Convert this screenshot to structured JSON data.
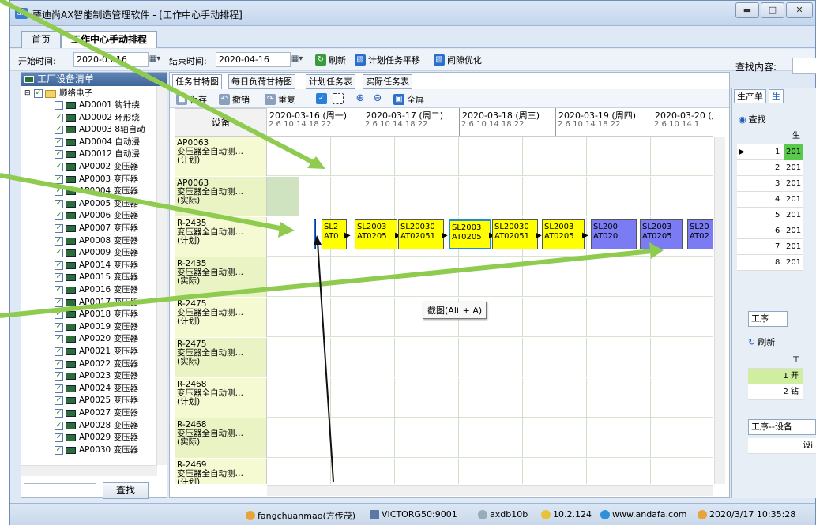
{
  "window": {
    "title": "要迪尚AX智能制造管理软件 - [工作中心手动排程]",
    "icon": "ax",
    "controls": [
      "minimize-icon",
      "maximize-icon",
      "close-icon"
    ]
  },
  "main_tabs": [
    {
      "label": "首页",
      "active": false
    },
    {
      "label": "工作中心手动排程",
      "active": true
    }
  ],
  "toolbar": {
    "start_label": "开始时间:",
    "start_value": "2020-03-16",
    "end_label": "结束时间:",
    "end_value": "2020-04-16",
    "refresh_label": "刷新",
    "shift_label": "计划任务平移",
    "optimize_label": "间隙优化",
    "search_label": "查找内容:"
  },
  "left_panel": {
    "title": "工厂设备清单",
    "root": "顺络电子",
    "items": [
      {
        "label": "AD0001 钩针绕"
      },
      {
        "label": "AD0002 环形绕"
      },
      {
        "label": "AD0003 8轴自动"
      },
      {
        "label": "AD0004 自动浸"
      },
      {
        "label": "AD0012 自动浸"
      },
      {
        "label": "AP0002 变压器"
      },
      {
        "label": "AP0003 变压器"
      },
      {
        "label": "AP0004 变压器"
      },
      {
        "label": "AP0005 变压器"
      },
      {
        "label": "AP0006 变压器"
      },
      {
        "label": "AP0007 变压器"
      },
      {
        "label": "AP0008 变压器"
      },
      {
        "label": "AP0009 变压器"
      },
      {
        "label": "AP0014 变压器"
      },
      {
        "label": "AP0015 变压器"
      },
      {
        "label": "AP0016 变压器"
      },
      {
        "label": "AP0017 变压器"
      },
      {
        "label": "AP0018 变压器"
      },
      {
        "label": "AP0019 变压器"
      },
      {
        "label": "AP0020 变压器"
      },
      {
        "label": "AP0021 变压器"
      },
      {
        "label": "AP0022 变压器"
      },
      {
        "label": "AP0023 变压器"
      },
      {
        "label": "AP0024 变压器"
      },
      {
        "label": "AP0025 变压器"
      },
      {
        "label": "AP0027 变压器"
      },
      {
        "label": "AP0028 变压器"
      },
      {
        "label": "AP0029 变压器"
      },
      {
        "label": "AP0030 变压器"
      }
    ],
    "find_button": "查找"
  },
  "center": {
    "tabs": [
      "任务甘特图",
      "每日负荷甘特图",
      "计划任务表",
      "实际任务表"
    ],
    "gantt_toolbar": {
      "save": "保存",
      "undo": "撤销",
      "redo": "重复",
      "fullscreen": "全屏"
    },
    "device_header": "设备",
    "days": [
      {
        "label": "2020-03-16 (周一)",
        "ticks": "2  6  10 14 18 22"
      },
      {
        "label": "2020-03-17 (周二)",
        "ticks": "2  6  10 14 18 22"
      },
      {
        "label": "2020-03-18 (周三)",
        "ticks": "2  6  10 14 18 22"
      },
      {
        "label": "2020-03-19 (周四)",
        "ticks": "2  6  10 14 18 22"
      },
      {
        "label": "2020-03-20 (周",
        "ticks": "2  6  10 14 1"
      }
    ],
    "rows": [
      {
        "code": "AP0063",
        "name": "变压器全自动测…",
        "kind": "(计划)"
      },
      {
        "code": "AP0063",
        "name": "变压器全自动测…",
        "kind": "(实际)"
      },
      {
        "code": "R-2435",
        "name": "变压器全自动测…",
        "kind": "(计划)"
      },
      {
        "code": "R-2435",
        "name": "变压器全自动测…",
        "kind": "(实际)"
      },
      {
        "code": "R-2475",
        "name": "变压器全自动测…",
        "kind": "(计划)"
      },
      {
        "code": "R-2475",
        "name": "变压器全自动测…",
        "kind": "(实际)"
      },
      {
        "code": "R-2468",
        "name": "变压器全自动测…",
        "kind": "(计划)"
      },
      {
        "code": "R-2468",
        "name": "变压器全自动测…",
        "kind": "(实际)"
      },
      {
        "code": "R-2469",
        "name": "变压器全自动测…",
        "kind": "(计划)"
      }
    ],
    "bars": [
      {
        "l1": "SL2",
        "l2": "AT0",
        "color": "yellow"
      },
      {
        "l1": "SL2003",
        "l2": "AT0205",
        "color": "yellow"
      },
      {
        "l1": "SL20030",
        "l2": "AT02051",
        "color": "yellow"
      },
      {
        "l1": "SL2003",
        "l2": "AT0205",
        "color": "yellow",
        "selected": true
      },
      {
        "l1": "SL20030",
        "l2": "AT02051",
        "color": "yellow"
      },
      {
        "l1": "SL2003",
        "l2": "AT0205",
        "color": "yellow"
      },
      {
        "l1": "SL200",
        "l2": "AT020",
        "color": "blue"
      },
      {
        "l1": "SL2003",
        "l2": "AT0205",
        "color": "blue"
      },
      {
        "l1": "SL20",
        "l2": "AT02",
        "color": "blue"
      }
    ],
    "tooltip": "截图(Alt + A)",
    "last_row_code": "R-2469"
  },
  "right_panel": {
    "tabs": [
      "生产单",
      "生"
    ],
    "find": "查找",
    "grid_header": "生",
    "grid_rows": [
      {
        "n": "1",
        "v": "201"
      },
      {
        "n": "2",
        "v": "201"
      },
      {
        "n": "3",
        "v": "201"
      },
      {
        "n": "4",
        "v": "201"
      },
      {
        "n": "5",
        "v": "201"
      },
      {
        "n": "6",
        "v": "201"
      },
      {
        "n": "7",
        "v": "201"
      },
      {
        "n": "8",
        "v": "201"
      }
    ],
    "process_tab": "工序",
    "refresh": "刷新",
    "proc_header": "工",
    "proc_rows": [
      {
        "n": "1",
        "v": "开"
      },
      {
        "n": "2",
        "v": "钻"
      }
    ],
    "device_tab": "工序--设备",
    "device_header": "设i"
  },
  "statusbar": {
    "user": "fangchuanmao(方传茂)",
    "server": "VICTORG50:9001",
    "db": "axdb10b",
    "ip": "10.2.124",
    "site": "www.andafa.com",
    "datetime": "2020/3/17 10:35:28"
  },
  "colors": {
    "bar_yellow": "#ffff00",
    "bar_blue": "#7b7bf3",
    "arrow_green": "#8ecb4e"
  }
}
